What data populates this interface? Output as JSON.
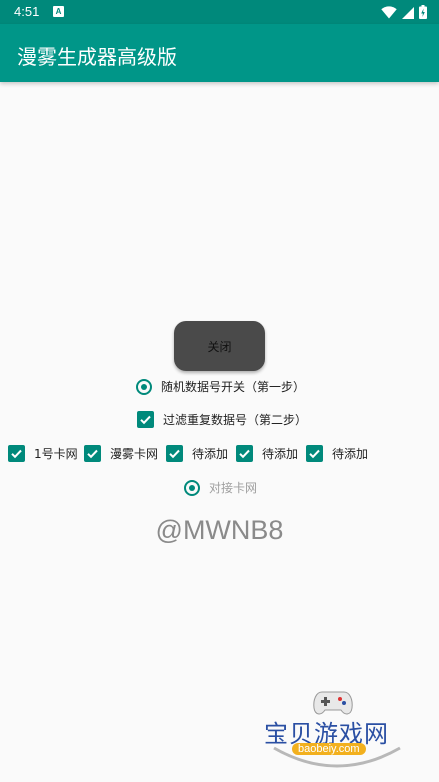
{
  "status_bar": {
    "time": "4:51",
    "notification_letter": "A"
  },
  "app_bar": {
    "title": "漫雾生成器高级版"
  },
  "main": {
    "close_button": "关闭",
    "step1_radio": "随机数据号开关（第一步）",
    "step2_checkbox": "过滤重复数据号（第二步）",
    "card_options": [
      {
        "label": "1号卡网"
      },
      {
        "label": "漫雾卡网"
      },
      {
        "label": "待添加"
      },
      {
        "label": "待添加"
      },
      {
        "label": "待添加"
      }
    ],
    "connect_radio": "对接卡网",
    "handle": "@MWNB8"
  },
  "watermark": {
    "name": "宝贝游戏网",
    "url": "baobeiy.com"
  },
  "colors": {
    "primary": "#009688",
    "status_bar": "#00897b",
    "accent": "#00897b"
  }
}
